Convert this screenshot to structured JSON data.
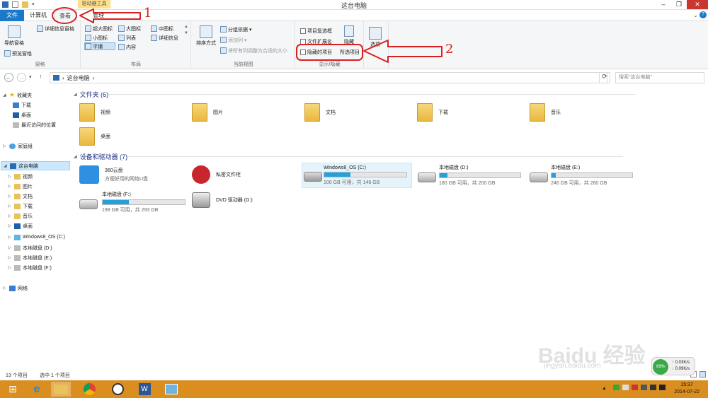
{
  "window": {
    "title": "这台电脑",
    "context_tab_label": "驱动器工具"
  },
  "tabs": {
    "file": "文件",
    "computer": "计算机",
    "view": "查看",
    "manage": "管理"
  },
  "ribbon": {
    "pane": {
      "nav_pane": "导航窗格",
      "preview_pane": "预览窗格",
      "details_pane": "详细信息窗格",
      "group": "窗格"
    },
    "layout": {
      "extra_large": "超大图标",
      "large": "大图标",
      "medium": "中图标",
      "small": "小图标",
      "list": "列表",
      "details": "详细信息",
      "tiles": "平铺",
      "content": "内容",
      "group": "布局"
    },
    "current_view": {
      "sort": "排序方式",
      "group_by": "分组依据",
      "add_columns": "添加列",
      "fit_columns": "将所有列调整为合适的大小",
      "group": "当前视图"
    },
    "show_hide": {
      "item_checkboxes": "项目复选框",
      "file_extensions": "文件扩展名",
      "hidden_items": "隐藏的项目",
      "hide_selected": "所选项目",
      "hide": "隐藏",
      "group": "显示/隐藏"
    },
    "options": "选项"
  },
  "address": {
    "crumb": "这台电脑",
    "search_placeholder": "搜索\"这台电脑\""
  },
  "nav": {
    "favorites": "收藏夹",
    "downloads": "下载",
    "desktop": "桌面",
    "recent": "最近访问的位置",
    "homegroup": "家庭组",
    "this_pc": "这台电脑",
    "videos": "视频",
    "pictures": "图片",
    "documents": "文档",
    "downloads2": "下载",
    "music": "音乐",
    "desktop2": "桌面",
    "drive_c": "Windows8_OS (C:)",
    "drive_d": "本地磁盘 (D:)",
    "drive_e": "本地磁盘 (E:)",
    "drive_f": "本地磁盘 (F:)",
    "network": "网络"
  },
  "folders": {
    "header": "文件夹 (6)",
    "items": [
      "视频",
      "图片",
      "文档",
      "下载",
      "音乐",
      "桌面"
    ]
  },
  "devices": {
    "header": "设备和驱动器 (7)",
    "cloud_name": "360云盘",
    "cloud_sub": "方便好用的网络U盘",
    "private_folder": "私密文件柜",
    "dvd": "DVD 驱动器 (G:)",
    "drives": [
      {
        "name": "Windows8_OS (C:)",
        "info": "100 GB 可用，共 146 GB",
        "used": 0.32
      },
      {
        "name": "本地磁盘 (D:)",
        "info": "180 GB 可用，共 200 GB",
        "used": 0.1
      },
      {
        "name": "本地磁盘 (E:)",
        "info": "246 GB 可用，共 260 GB",
        "used": 0.05
      },
      {
        "name": "本地磁盘 (F:)",
        "info": "199 GB 可用，共 293 GB",
        "used": 0.32
      }
    ]
  },
  "status": {
    "count": "13 个项目",
    "selected": "选中 1 个项目"
  },
  "taskbar": {
    "time": "15:37",
    "date": "2014-07-22"
  },
  "speed": {
    "percent": "69%",
    "up": "0.03K/s",
    "down": "0.09K/s"
  },
  "annotations": {
    "one": "1",
    "two": "2",
    "watermark": "Baidu 经验",
    "watermark_sub": "jingyan.baidu.com"
  }
}
